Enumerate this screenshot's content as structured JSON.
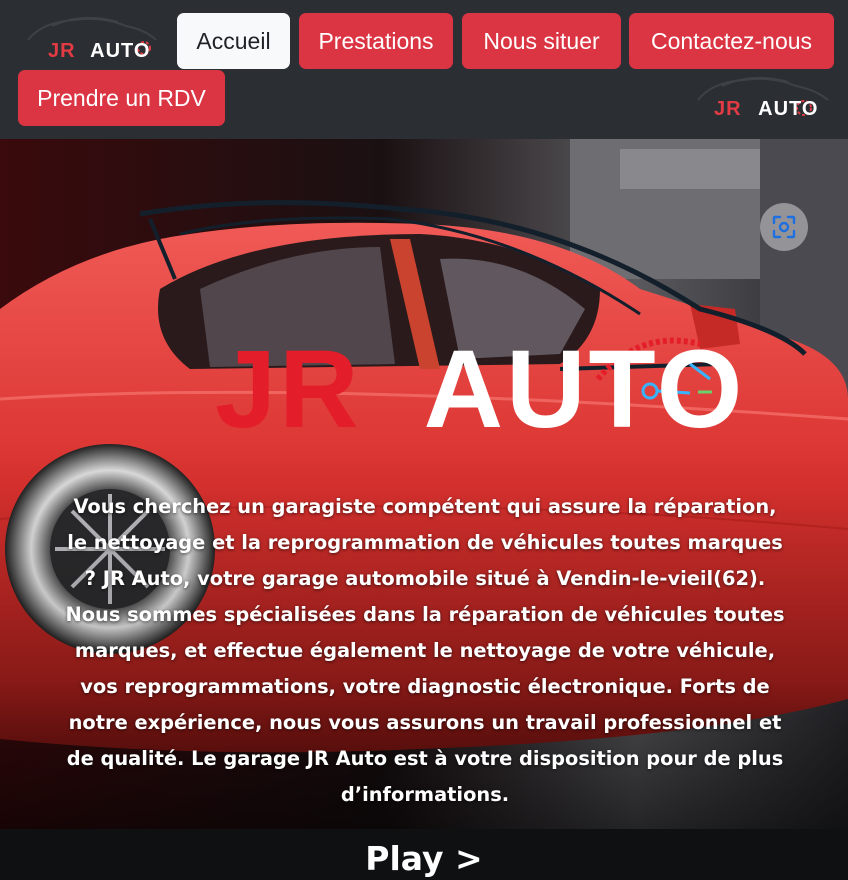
{
  "brand": {
    "logo_jr": "JR",
    "logo_auto": "AUTO",
    "colors": {
      "red": "#db3443",
      "logo_red": "#e31e2a",
      "navbar": "#2b2f33"
    }
  },
  "nav": {
    "items": [
      {
        "label": "Accueil",
        "active": true
      },
      {
        "label": "Prestations",
        "active": false
      },
      {
        "label": "Nous situer",
        "active": false
      },
      {
        "label": "Contactez-nous",
        "active": false
      },
      {
        "label": "Prendre un RDV",
        "active": false
      }
    ]
  },
  "hero": {
    "logo_jr": "JR",
    "logo_auto": "AUTO",
    "screen_icon": "screen-capture-icon",
    "intro_text": "Vous cherchez un garagiste compétent qui assure la réparation, le nettoyage et la reprogrammation de véhicules toutes marques ? JR Auto, votre garage automobile situé à Vendin-le-vieil(62). Nous sommes spécialisées dans la réparation de véhicules toutes marques, et effectue également le nettoyage de votre véhicule, vos reprogrammations, votre diagnostic électronique. Forts de notre expérience, nous vous assurons un travail professionnel et de qualité. Le garage JR Auto est à votre disposition pour de plus d’informations.",
    "play_label": "Play >"
  }
}
